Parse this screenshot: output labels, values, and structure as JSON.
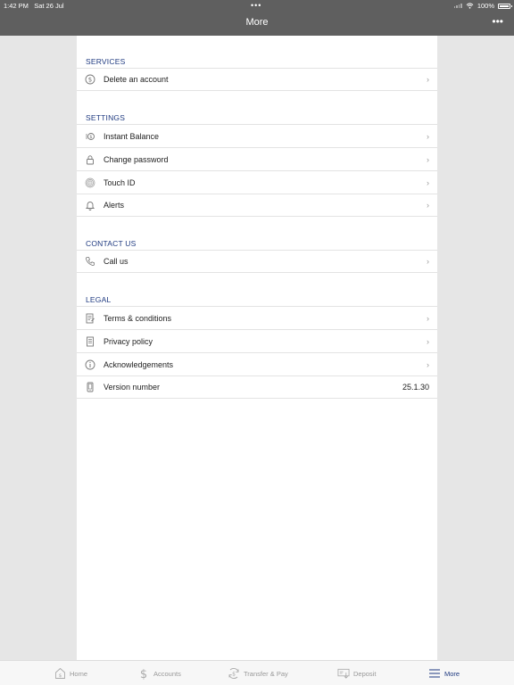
{
  "status": {
    "time": "1:42 PM",
    "date": "Sat 26 Jul",
    "battery": "100%",
    "dots": "•••"
  },
  "nav": {
    "title": "More",
    "menu": "•••"
  },
  "sections": {
    "services": {
      "header": "SERVICES",
      "items": [
        {
          "label": "Delete an account"
        }
      ]
    },
    "settings": {
      "header": "SETTINGS",
      "items": [
        {
          "label": "Instant Balance"
        },
        {
          "label": "Change password"
        },
        {
          "label": "Touch ID"
        },
        {
          "label": "Alerts"
        }
      ]
    },
    "contact": {
      "header": "CONTACT US",
      "items": [
        {
          "label": "Call us"
        }
      ]
    },
    "legal": {
      "header": "LEGAL",
      "items": [
        {
          "label": "Terms & conditions"
        },
        {
          "label": "Privacy policy"
        },
        {
          "label": "Acknowledgements"
        },
        {
          "label": "Version number",
          "value": "25.1.30"
        }
      ]
    }
  },
  "chevron": "›",
  "tabs": [
    {
      "label": "Home",
      "icon": "home-icon"
    },
    {
      "label": "Accounts",
      "icon": "dollar-icon"
    },
    {
      "label": "Transfer & Pay",
      "icon": "transfer-icon"
    },
    {
      "label": "Deposit",
      "icon": "deposit-icon"
    },
    {
      "label": "More",
      "icon": "menu-icon",
      "active": true
    }
  ],
  "colors": {
    "bar": "#5f5f5f",
    "accent": "#1f3a80",
    "background": "#e6e6e6"
  }
}
